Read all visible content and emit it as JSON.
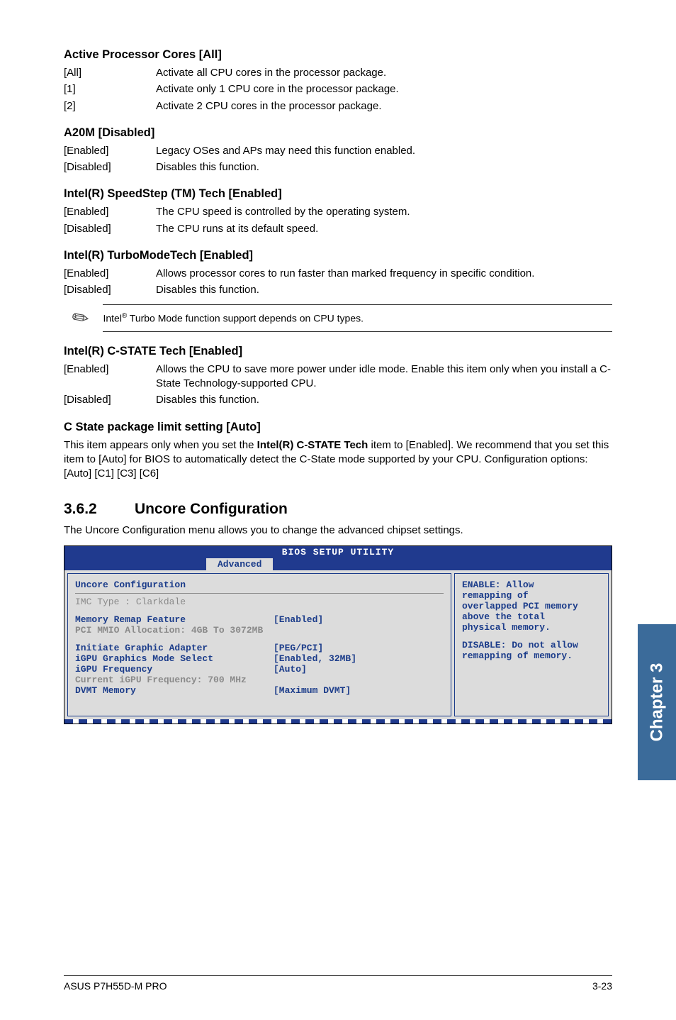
{
  "sections": {
    "activeCores": {
      "heading": "Active Processor Cores [All]",
      "rows": [
        {
          "term": "[All]",
          "desc": "Activate all CPU cores in the processor package."
        },
        {
          "term": "[1]",
          "desc": "Activate only 1 CPU core in the processor package."
        },
        {
          "term": "[2]",
          "desc": "Activate 2 CPU cores in the processor package."
        }
      ]
    },
    "a20m": {
      "heading": "A20M [Disabled]",
      "rows": [
        {
          "term": "[Enabled]",
          "desc": "Legacy OSes and APs may need this function enabled."
        },
        {
          "term": "[Disabled]",
          "desc": "Disables this function."
        }
      ]
    },
    "speedstep": {
      "heading": "Intel(R) SpeedStep (TM) Tech [Enabled]",
      "rows": [
        {
          "term": "[Enabled]",
          "desc": "The CPU speed is controlled by the operating system."
        },
        {
          "term": "[Disabled]",
          "desc": "The CPU runs at its default speed."
        }
      ]
    },
    "turbo": {
      "heading": "Intel(R) TurboModeTech [Enabled]",
      "rows": [
        {
          "term": "[Enabled]",
          "desc": "Allows processor cores to run faster than marked frequency in specific condition."
        },
        {
          "term": "[Disabled]",
          "desc": "Disables this function."
        }
      ],
      "note_pre": "Intel",
      "note_post": " Turbo Mode function support depends on CPU types."
    },
    "cstate": {
      "heading": "Intel(R) C-STATE Tech [Enabled]",
      "rows": [
        {
          "term": "[Enabled]",
          "desc": "Allows the CPU to save more power under idle mode. Enable this item only when you install a C-State Technology-supported CPU."
        },
        {
          "term": "[Disabled]",
          "desc": "Disables this function."
        }
      ]
    },
    "climit": {
      "heading": "C State package limit setting [Auto]",
      "body_pre": "This item appears only when you set the ",
      "body_bold": "Intel(R) C-STATE Tech",
      "body_post": " item to [Enabled]. We recommend that you set this item to [Auto] for BIOS to automatically detect the C-State mode supported by your CPU. Configuration options: [Auto] [C1] [C3] [C6]"
    }
  },
  "uncore": {
    "num": "3.6.2",
    "title": "Uncore Configuration",
    "intro": "The Uncore Configuration menu allows you to change the advanced chipset settings."
  },
  "bios": {
    "title": "BIOS SETUP UTILITY",
    "tab": "Advanced",
    "left": {
      "cfgtitle": "Uncore Configuration",
      "imc": "IMC Type : Clarkdale",
      "memRemap": {
        "label": "Memory Remap Feature",
        "value": "[Enabled]"
      },
      "pciMmio": " PCI MMIO Allocation: 4GB To 3072MB",
      "initGraphic": {
        "label": "Initiate Graphic Adapter",
        "value": "[PEG/PCI]"
      },
      "igpuMode": {
        "label": "iGPU Graphics Mode Select",
        "value": "[Enabled, 32MB]"
      },
      "igpuFreq": {
        "label": "iGPU Frequency",
        "value": "[Auto]"
      },
      "curFreq": " Current iGPU Frequency: 700 MHz",
      "dvmt": {
        "label": "DVMT Memory",
        "value": "[Maximum DVMT]"
      }
    },
    "right": {
      "l1": "ENABLE: Allow",
      "l2": "remapping of",
      "l3": "overlapped PCI memory",
      "l4": "above the total",
      "l5": "physical memory.",
      "l6": "DISABLE: Do not allow",
      "l7": "remapping of memory."
    }
  },
  "sidetab": "Chapter 3",
  "footer": {
    "left": "ASUS P7H55D-M PRO",
    "right": "3-23"
  }
}
